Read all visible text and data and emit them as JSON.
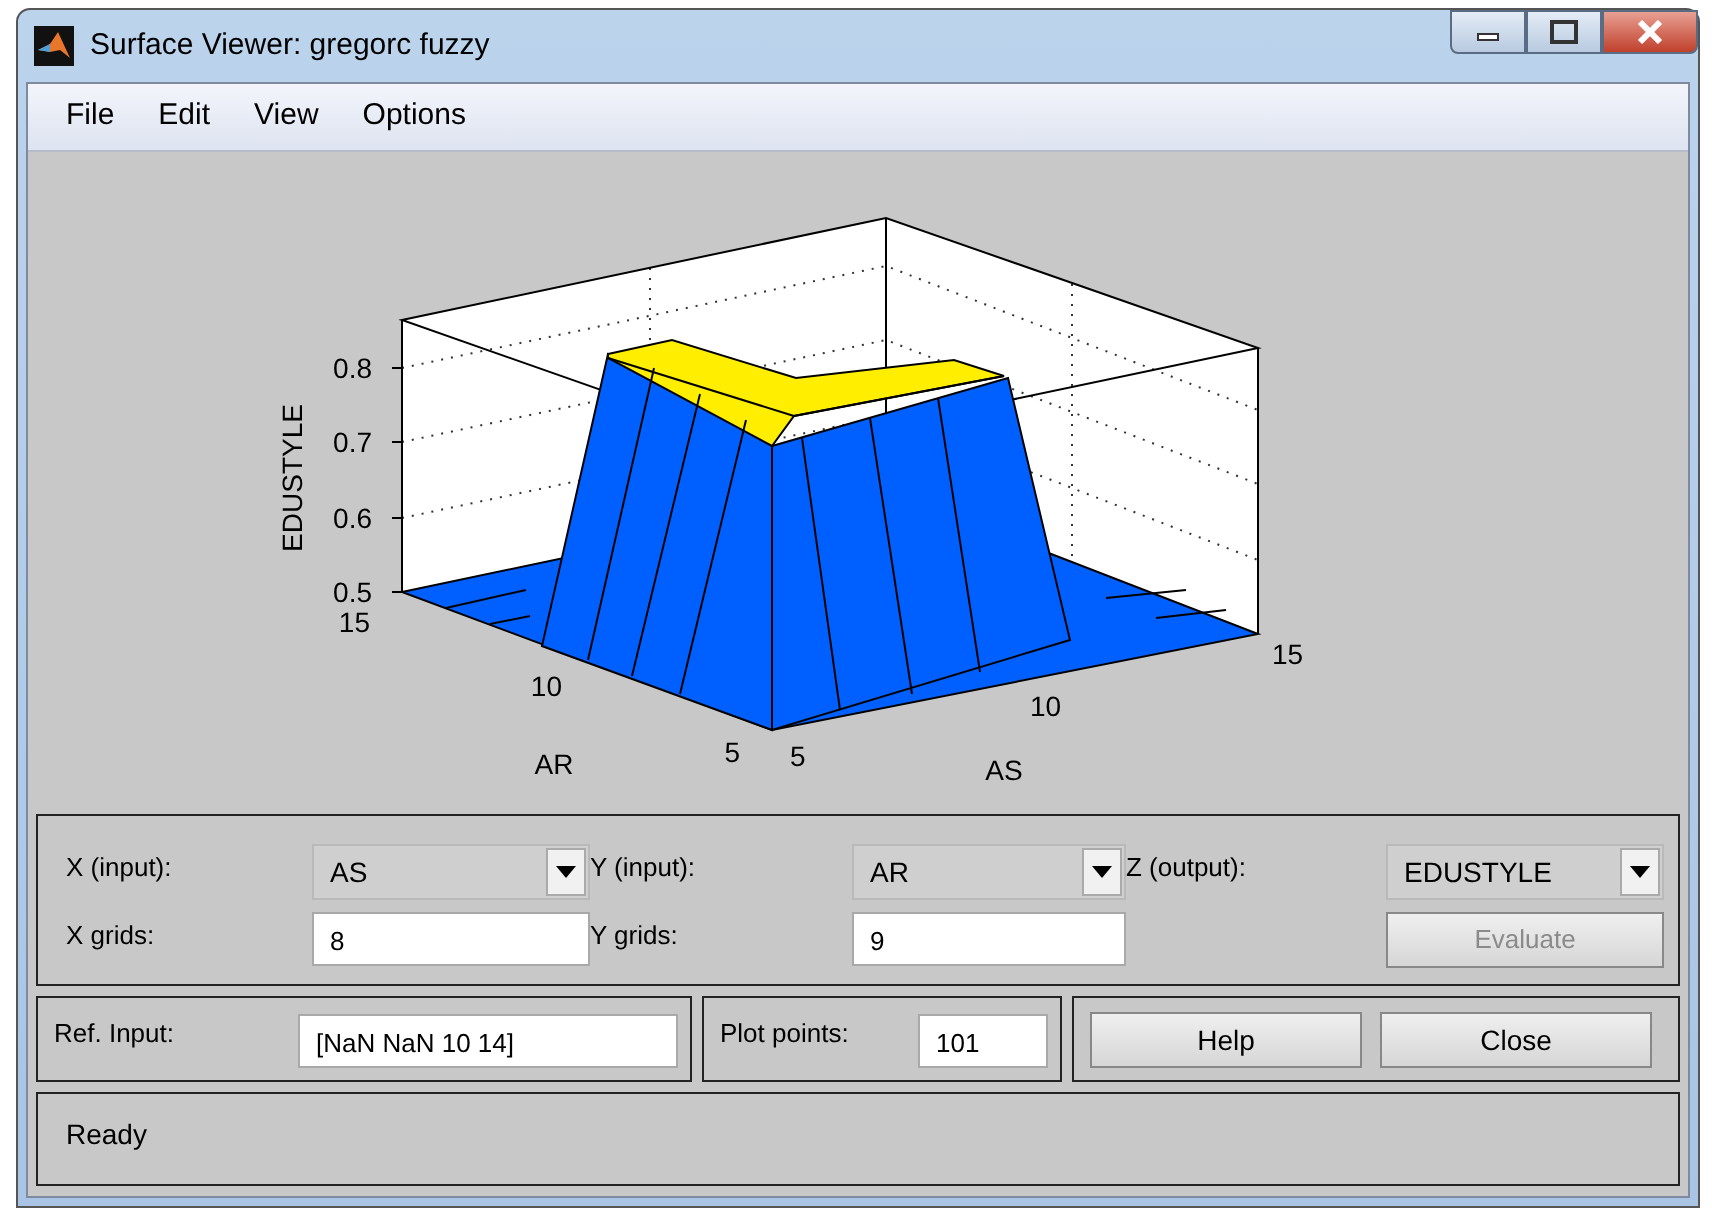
{
  "window": {
    "title": "Surface Viewer: gregorc fuzzy"
  },
  "menu": [
    "File",
    "Edit",
    "View",
    "Options"
  ],
  "plot": {
    "zlabel": "EDUSTYLE",
    "ylabel": "AR",
    "xlabel": "AS",
    "zticks": [
      "0.8",
      "0.7",
      "0.6",
      "0.5"
    ],
    "yticks": [
      "15",
      "10",
      "5"
    ],
    "xticks": [
      "5",
      "10",
      "15"
    ]
  },
  "axes": [
    {
      "label": "X (input):",
      "value": "AS"
    },
    {
      "label": "Y (input):",
      "value": "AR"
    },
    {
      "label": "Z (output):",
      "value": "EDUSTYLE"
    }
  ],
  "grids": [
    {
      "label": "X grids:",
      "value": "8"
    },
    {
      "label": "Y grids:",
      "value": "9"
    }
  ],
  "evaluate": {
    "label": "Evaluate",
    "disabled": true
  },
  "ref_input": {
    "label": "Ref. Input:",
    "value": "[NaN NaN 10 14]"
  },
  "plot_points": {
    "label": "Plot points:",
    "value": "101"
  },
  "buttons": [
    "Help",
    "Close"
  ],
  "status": "Ready"
}
